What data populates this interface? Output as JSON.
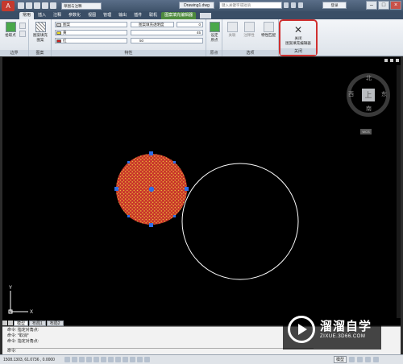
{
  "titlebar": {
    "app_letter": "A",
    "workspace": "草图与注释",
    "document": "Drawing1.dwg",
    "search_placeholder": "键入关键字或短语",
    "login": "登录",
    "minimize": "–",
    "maximize": "□",
    "close": "×"
  },
  "tabs": [
    "常用",
    "插入",
    "注释",
    "参数化",
    "视图",
    "管理",
    "输出",
    "插件",
    "联机",
    "图案填充编辑器"
  ],
  "active_tab": "常用",
  "context_tab": "图案填充编辑器",
  "ribbon": {
    "boundary": {
      "label": "边界",
      "pick_points": "拾取点",
      "big_btn": "图案填充\n图案"
    },
    "pattern": {
      "label": "图案"
    },
    "properties": {
      "label": "特性",
      "type": "图案",
      "color": "黄",
      "bg_color": "红",
      "transparency_label": "图案填充透明度",
      "transparency": "0",
      "angle": "45",
      "scale": "50"
    },
    "origin": {
      "label": "原点",
      "set_origin": "设定\n原点"
    },
    "options": {
      "label": "选项",
      "associative": "关联",
      "annotative": "注释性",
      "match": "特性匹配"
    },
    "close": {
      "label": "关闭",
      "button": "关闭\n图案填充编辑器"
    }
  },
  "viewcube": {
    "face": "上",
    "north": "北",
    "south": "南",
    "east": "东",
    "west": "西",
    "wcs": "WCS"
  },
  "layout_tabs": [
    "模型",
    "布局1",
    "布局2"
  ],
  "active_layout": "模型",
  "command_lines": [
    "命令: 指定对角点:",
    "命令: *取消*",
    "命令: 指定对角点:",
    "命令:"
  ],
  "status": {
    "coords": "1508.1303, 61.0736 , 0.0000",
    "model": "模型"
  },
  "watermark": {
    "cn": "溜溜自学",
    "url": "ZIXUE.3D66.COM"
  },
  "colors": {
    "hatch": "#d4372c",
    "hatch_dots": "#f0d23a",
    "grip": "#2f6fe6",
    "selection_border": "#d03030"
  }
}
